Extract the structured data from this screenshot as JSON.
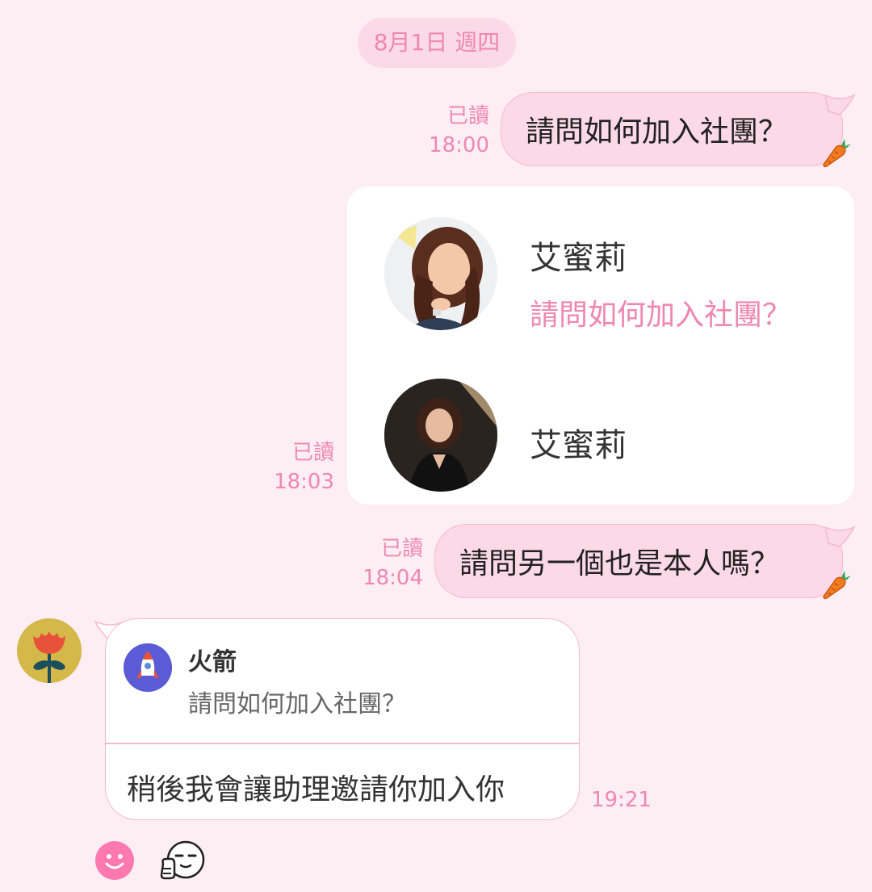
{
  "date_label": "8月1日 週四",
  "messages": [
    {
      "read_label": "已讀",
      "time": "18:00",
      "text": "請問如何加入社團？"
    },
    {
      "read_label": "已讀",
      "time": "18:03",
      "contacts": [
        {
          "name": "艾蜜莉",
          "status": "請問如何加入社團？"
        },
        {
          "name": "艾蜜莉"
        }
      ]
    },
    {
      "read_label": "已讀",
      "time": "18:04",
      "text": "請問另一個也是本人嗎？"
    }
  ],
  "incoming": {
    "quote": {
      "name": "火箭",
      "text": "請問如何加入社團？"
    },
    "text": "稍後我會讓助理邀請你加入你",
    "time": "19:21"
  },
  "colors": {
    "background": "#fdeef4",
    "outgoing_bubble": "#fcd9e6",
    "accent": "#ee88b1"
  },
  "icons": [
    "carrot-icon",
    "flower-avatar-icon",
    "rocket-icon",
    "smiley-icon",
    "thumbs-up-face-sticker"
  ]
}
